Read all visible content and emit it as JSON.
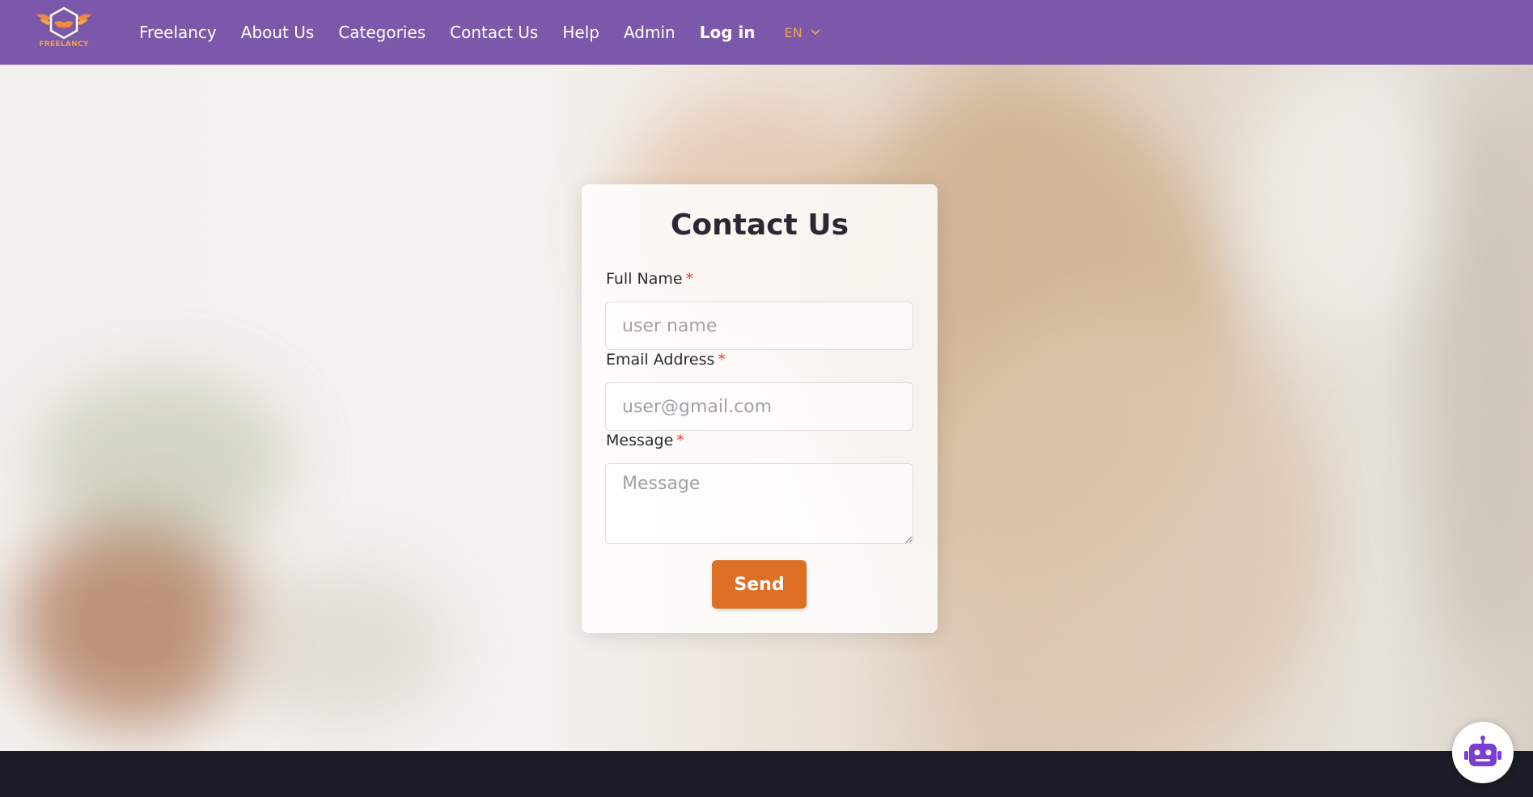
{
  "brand": {
    "name": "FREELANCY",
    "logo_icon": "handshake-logo-icon"
  },
  "nav": {
    "items": [
      {
        "label": "Freelancy"
      },
      {
        "label": "About Us"
      },
      {
        "label": "Categories"
      },
      {
        "label": "Contact Us"
      },
      {
        "label": "Help"
      },
      {
        "label": "Admin"
      }
    ],
    "login_label": "Log in",
    "language": "EN"
  },
  "contact_form": {
    "title": "Contact Us",
    "required_marker": "*",
    "full_name": {
      "label": "Full Name",
      "placeholder": "user name",
      "value": ""
    },
    "email": {
      "label": "Email Address",
      "placeholder": "user@gmail.com",
      "value": ""
    },
    "message": {
      "label": "Message",
      "placeholder": "Message",
      "value": ""
    },
    "send_label": "Send"
  },
  "chatbot": {
    "icon": "robot-icon"
  },
  "colors": {
    "navbar": "#7b58a9",
    "accent": "#de7025",
    "language": "#f0a25a",
    "required": "#e0423a",
    "footer": "#1b1d28",
    "robot": "#7b3fd0"
  }
}
